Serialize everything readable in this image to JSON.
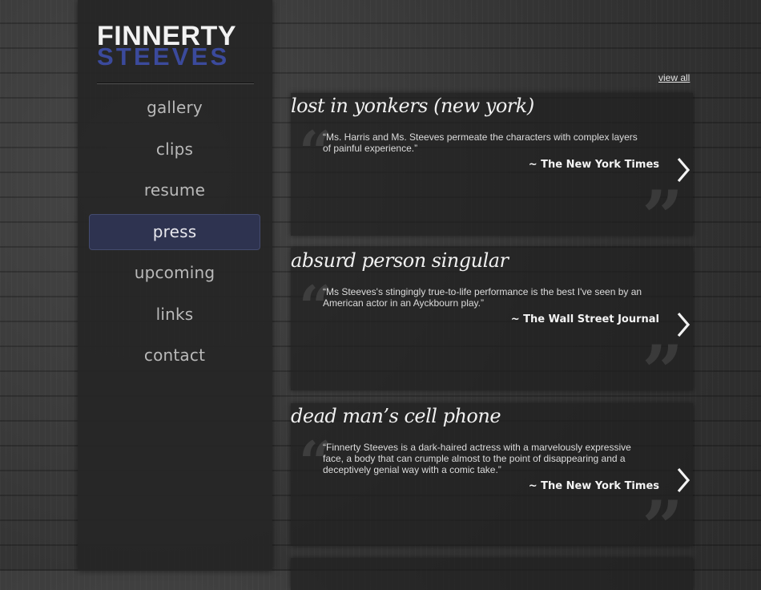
{
  "logo": {
    "line1": "FINNERTY",
    "line2": "STEEVES"
  },
  "nav": {
    "items": [
      {
        "label": "gallery"
      },
      {
        "label": "clips"
      },
      {
        "label": "resume"
      },
      {
        "label": "press"
      },
      {
        "label": "upcoming"
      },
      {
        "label": "links"
      },
      {
        "label": "contact"
      }
    ],
    "active": "press"
  },
  "main": {
    "view_all_label": "view all",
    "press_items": [
      {
        "title": "lost in yonkers (new york)",
        "quote": "“Ms. Harris and Ms. Steeves permeate the characters with complex layers of painful experience.”",
        "source": "~ The New York Times"
      },
      {
        "title": "absurd person singular",
        "quote": "“Ms Steeves's stingingly true-to-life performance is the best I've seen by an American actor in an Ayckbourn play.”",
        "source": "~ The Wall Street Journal"
      },
      {
        "title": "dead man’s cell phone",
        "quote": "“Finnerty Steeves is a dark-haired actress with a marvelously expressive face, a body that can crumple almost to the point of disappearing and a deceptively genial way with a comic take.”",
        "source": "~ The New York Times"
      }
    ]
  },
  "colors": {
    "accent_blue": "#3b4a9c",
    "active_nav_bg": "#2e3350"
  },
  "icons": {
    "next": "chevron-right-icon",
    "quote_open": "open-quote-icon",
    "quote_close": "close-quote-icon"
  }
}
